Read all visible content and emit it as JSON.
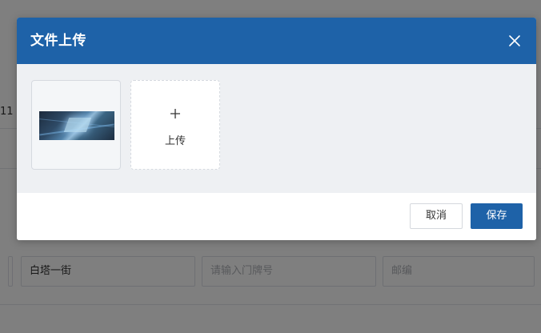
{
  "background": {
    "partial_text": "11",
    "fields": {
      "street_value": "白塔一街",
      "door_number_placeholder": "请输入门牌号",
      "postcode_placeholder": "邮编"
    }
  },
  "dialog": {
    "title": "文件上传",
    "upload_label": "上传",
    "cancel_label": "取消",
    "save_label": "保存"
  },
  "colors": {
    "primary": "#1e62a8",
    "body_bg": "#eef0f3",
    "mask": "rgba(0,0,0,0.5)"
  },
  "icons": [
    "close-icon",
    "plus-icon"
  ]
}
